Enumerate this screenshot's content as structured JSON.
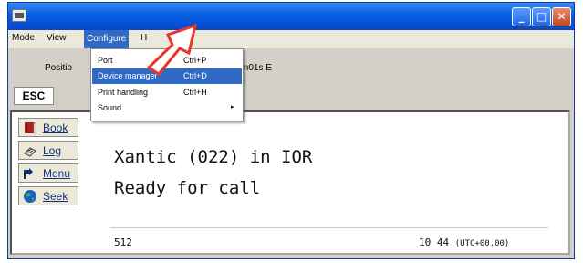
{
  "window": {
    "buttons": {
      "minimize": "_",
      "maximize": "□",
      "close": "✕"
    }
  },
  "menubar": {
    "items": [
      "Mode",
      "View",
      "Configure",
      "H"
    ]
  },
  "position": {
    "label": "Positio",
    "value": "m01s E"
  },
  "esc_label": "ESC",
  "sidebar": [
    {
      "label": "Book",
      "icon": "book-icon"
    },
    {
      "label": "Log",
      "icon": "log-icon"
    },
    {
      "label": "Menu",
      "icon": "menu-icon"
    },
    {
      "label": "Seek",
      "icon": "globe-icon"
    }
  ],
  "display": {
    "line1": "Xantic (022) in IOR",
    "line2": "Ready for call"
  },
  "status": {
    "left": "512",
    "time": "10 44",
    "tz": "(UTC+00.00)"
  },
  "dropdown": [
    {
      "label": "Port",
      "shortcut": "Ctrl+P"
    },
    {
      "label": "Device manager",
      "shortcut": "Ctrl+D"
    },
    {
      "label": "Print handling",
      "shortcut": "Ctrl+H"
    },
    {
      "label": "Sound",
      "shortcut": "",
      "submenu": "▸"
    }
  ],
  "colors": {
    "selection": "#316ac5",
    "title_bar": "#0b61e3",
    "arrow": "#e8362b"
  }
}
